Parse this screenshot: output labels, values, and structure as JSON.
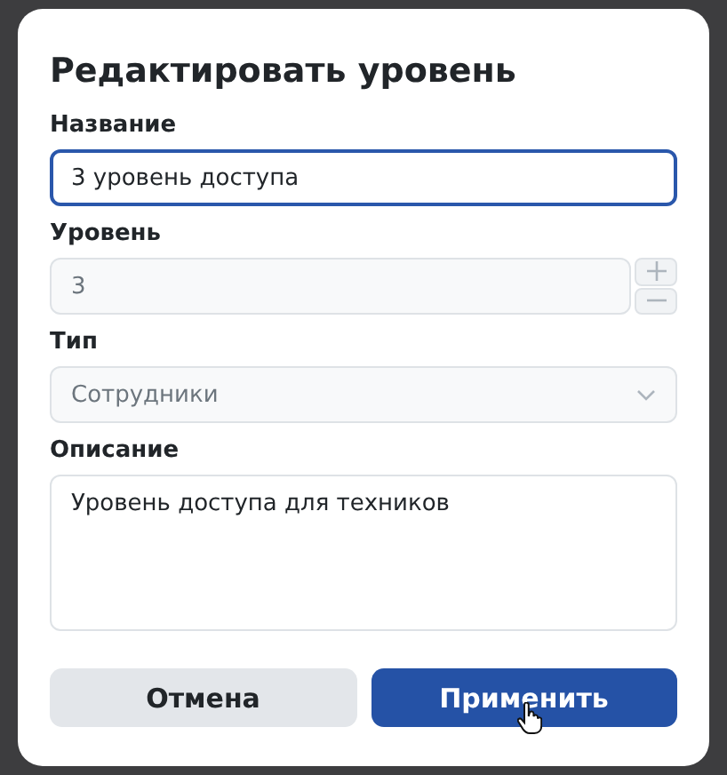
{
  "dialog": {
    "title": "Редактировать уровень",
    "fields": [
      {
        "kind": "text",
        "label": "Название",
        "value": "3 уровень доступа",
        "focused": true,
        "disabled": false
      },
      {
        "kind": "number",
        "label": "Уровень",
        "value": "3",
        "focused": false,
        "disabled": true
      },
      {
        "kind": "select",
        "label": "Тип",
        "value": "Сотрудники",
        "focused": false,
        "disabled": true
      },
      {
        "kind": "textarea",
        "label": "Описание",
        "value": "Уровень доступа для техников",
        "focused": false,
        "disabled": false
      }
    ],
    "buttons": [
      {
        "kind": "secondary",
        "label": "Отмена",
        "hovered": false
      },
      {
        "kind": "primary",
        "label": "Применить",
        "hovered": true
      }
    ]
  }
}
